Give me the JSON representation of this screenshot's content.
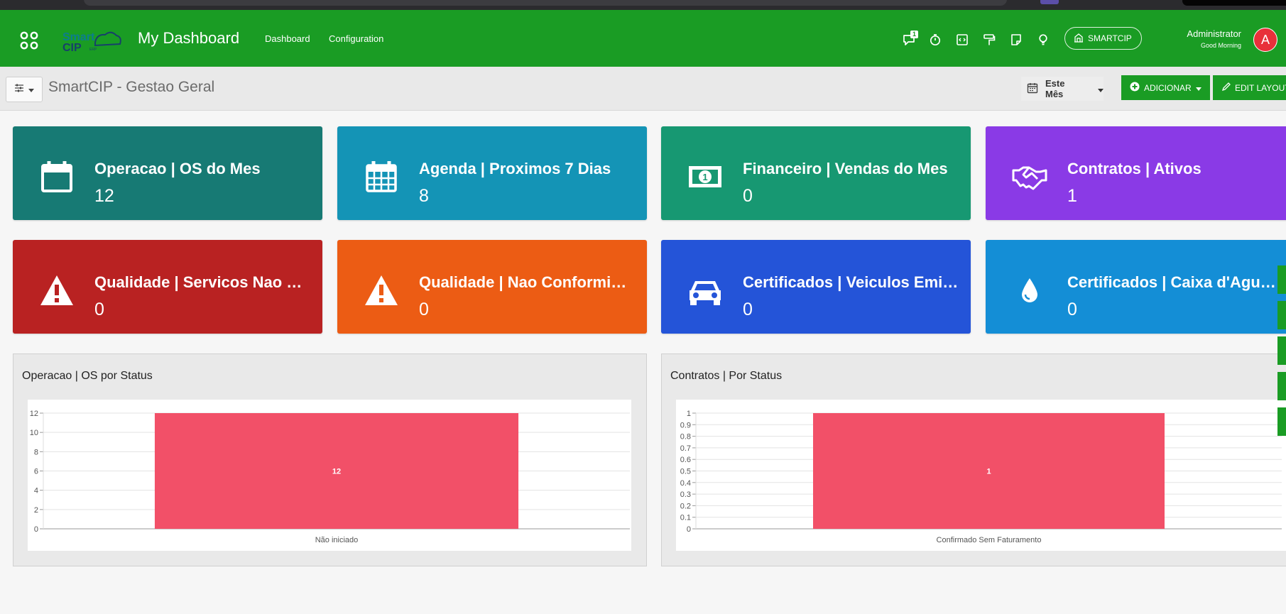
{
  "navbar": {
    "title": "My Dashboard",
    "links": [
      "Dashboard",
      "Configuration"
    ],
    "messages_badge": "1",
    "company_label": "SMARTCIP",
    "user_name": "Administrator",
    "greeting": "Good Morning",
    "avatar_letter": "A",
    "icons": [
      "chat-icon",
      "stopwatch-icon",
      "code-icon",
      "paint-roller-icon",
      "note-icon",
      "lightbulb-icon",
      "building-icon"
    ]
  },
  "control_bar": {
    "page_title": "SmartCIP - Gestao Geral",
    "period": "Este Mês",
    "add_button": "ADICIONAR",
    "edit_layout_button": "EDIT LAYOUT"
  },
  "cards": [
    {
      "label": "Operacao | OS do Mes",
      "value": "12",
      "icon": "calendar-icon",
      "color": "#177a74"
    },
    {
      "label": "Agenda | Proximos 7 Dias",
      "value": "8",
      "icon": "calendar-grid-icon",
      "color": "#1494b6"
    },
    {
      "label": "Financeiro | Vendas do Mes",
      "value": "0",
      "icon": "money-bill-icon",
      "color": "#179872"
    },
    {
      "label": "Contratos | Ativos",
      "value": "1",
      "icon": "handshake-icon",
      "color": "#8a3ae6"
    },
    {
      "label": "Qualidade | Servicos Nao Realizados",
      "value": "0",
      "icon": "warning-icon",
      "color": "#b92222"
    },
    {
      "label": "Qualidade | Nao Conformidades",
      "value": "0",
      "icon": "warning-icon",
      "color": "#ec5c14"
    },
    {
      "label": "Certificados | Veiculos Emitidos",
      "value": "0",
      "icon": "car-icon",
      "color": "#2454d8"
    },
    {
      "label": "Certificados | Caixa d'Agua Emitidos",
      "value": "0",
      "icon": "water-drop-icon",
      "color": "#148ed6"
    }
  ],
  "panels": [
    {
      "title": "Operacao | OS por Status"
    },
    {
      "title": "Contratos | Por Status"
    }
  ],
  "chart_data": [
    {
      "type": "bar",
      "title": "Operacao | OS por Status",
      "categories": [
        "Não iniciado"
      ],
      "values": [
        12
      ],
      "ylim": [
        0,
        12
      ],
      "yticks": [
        "0",
        "2",
        "4",
        "6",
        "8",
        "10",
        "12"
      ],
      "bar_color": "#f25068",
      "grid": true
    },
    {
      "type": "bar",
      "title": "Contratos | Por Status",
      "categories": [
        "Confirmado Sem Faturamento"
      ],
      "values": [
        1
      ],
      "ylim": [
        0,
        1
      ],
      "yticks": [
        "0",
        "0.1",
        "0.2",
        "0.3",
        "0.4",
        "0.5",
        "0.6",
        "0.7",
        "0.8",
        "0.9",
        "1"
      ],
      "bar_color": "#f25068",
      "grid": true
    }
  ]
}
